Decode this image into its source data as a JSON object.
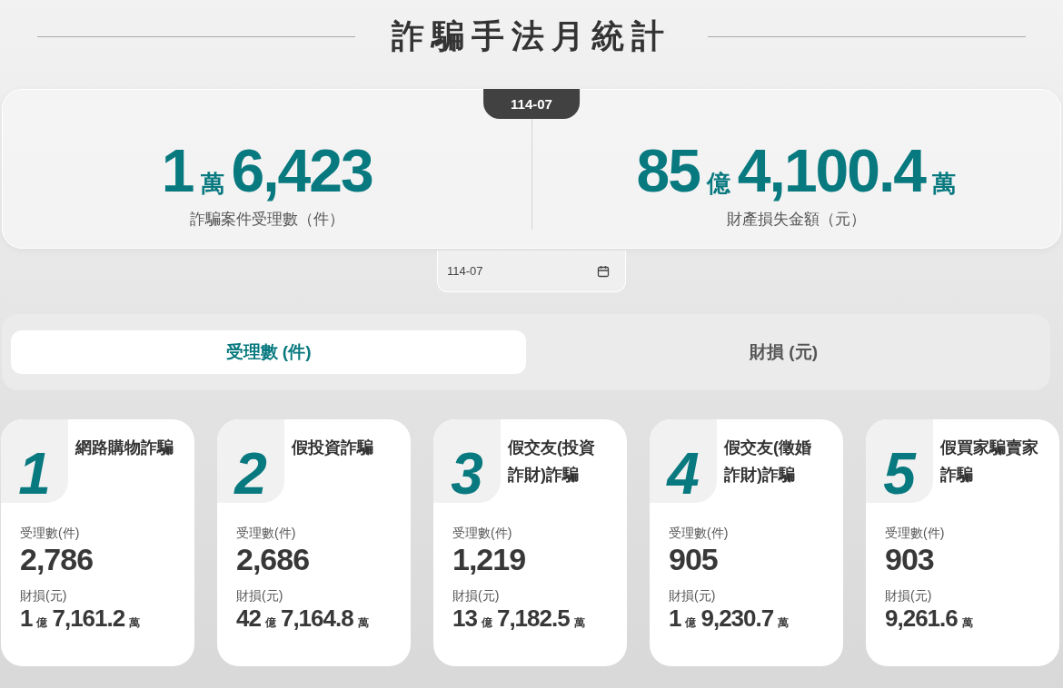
{
  "title": "詐騙手法月統計",
  "summary": {
    "badge": "114-07",
    "stats": [
      {
        "value": [
          {
            "kind": "number",
            "text": "1"
          },
          {
            "kind": "unit",
            "text": "萬"
          },
          {
            "kind": "number",
            "text": "6,423"
          }
        ],
        "label": "詐騙案件受理數（件）"
      },
      {
        "value": [
          {
            "kind": "number",
            "text": "85"
          },
          {
            "kind": "unit",
            "text": "億"
          },
          {
            "kind": "number",
            "text": "4,100.4"
          },
          {
            "kind": "unit",
            "text": "萬"
          }
        ],
        "label": "財產損失金額（元）"
      }
    ]
  },
  "date_field": {
    "value": "114-07"
  },
  "tabs": [
    {
      "label": "受理數 (件)",
      "selected": true
    },
    {
      "label": "財損 (元)",
      "selected": false
    }
  ],
  "cards": [
    {
      "rank": "1",
      "name": "網路購物詐騙",
      "count_label": "受理數(件)",
      "count": "2,786",
      "loss_label": "財損(元)",
      "loss": [
        {
          "kind": "number",
          "text": "1"
        },
        {
          "kind": "unit",
          "text": "億"
        },
        {
          "kind": "number",
          "text": "7,161.2"
        },
        {
          "kind": "unit",
          "text": "萬"
        }
      ]
    },
    {
      "rank": "2",
      "name": "假投資詐騙",
      "count_label": "受理數(件)",
      "count": "2,686",
      "loss_label": "財損(元)",
      "loss": [
        {
          "kind": "number",
          "text": "42"
        },
        {
          "kind": "unit",
          "text": "億"
        },
        {
          "kind": "number",
          "text": "7,164.8"
        },
        {
          "kind": "unit",
          "text": "萬"
        }
      ]
    },
    {
      "rank": "3",
      "name": "假交友(投資詐財)詐騙",
      "count_label": "受理數(件)",
      "count": "1,219",
      "loss_label": "財損(元)",
      "loss": [
        {
          "kind": "number",
          "text": "13"
        },
        {
          "kind": "unit",
          "text": "億"
        },
        {
          "kind": "number",
          "text": "7,182.5"
        },
        {
          "kind": "unit",
          "text": "萬"
        }
      ]
    },
    {
      "rank": "4",
      "name": "假交友(徵婚詐財)詐騙",
      "count_label": "受理數(件)",
      "count": "905",
      "loss_label": "財損(元)",
      "loss": [
        {
          "kind": "number",
          "text": "1"
        },
        {
          "kind": "unit",
          "text": "億"
        },
        {
          "kind": "number",
          "text": "9,230.7"
        },
        {
          "kind": "unit",
          "text": "萬"
        }
      ]
    },
    {
      "rank": "5",
      "name": "假買家騙賣家詐騙",
      "count_label": "受理數(件)",
      "count": "903",
      "loss_label": "財損(元)",
      "loss": [
        {
          "kind": "number",
          "text": "9,261.6"
        },
        {
          "kind": "unit",
          "text": "萬"
        }
      ]
    }
  ]
}
